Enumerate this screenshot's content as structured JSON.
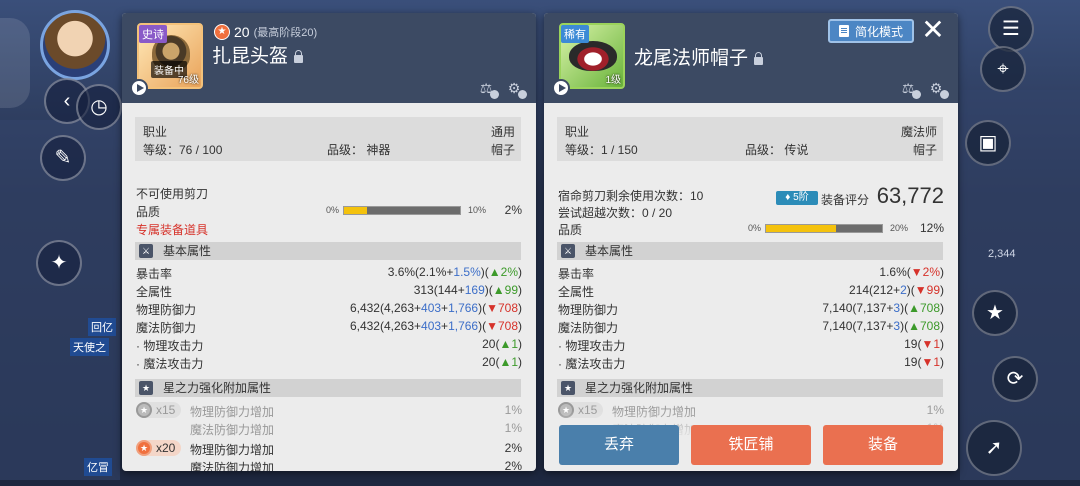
{
  "colors": {
    "panel_header": "#3c4a63",
    "accent_orange": "#ea7050",
    "accent_blue": "#4a7fab",
    "stat_up": "#3c9a2a",
    "stat_down": "#d6322a",
    "bonus_blue": "#3c6ec8"
  },
  "background": {
    "side_label_1": "回亿",
    "side_label_2": "天使之",
    "side_label_3": "亿冒",
    "right_value": "2,344"
  },
  "left_item": {
    "rarity": "史诗",
    "equipped_tag": "装备中",
    "level_tag": "76级",
    "star_count": "20",
    "star_max": "(最高阶段20)",
    "name": "扎昆头盔",
    "info": {
      "job_label": "职业",
      "job_value": "通用",
      "level": "等级：76 / 100",
      "grade": "品级：  神器",
      "type": "帽子"
    },
    "scissors": "不可使用剪刀",
    "quality_label": "品质",
    "quality_min": "0%",
    "quality_max": "10%",
    "quality_value": "2%",
    "quality_fill": 0.2,
    "exclusive": "专属装备道具",
    "basic_section": "基本属性",
    "stats": [
      {
        "name": "暴击率",
        "base": "3.6%(2.1%+",
        "bonus": "1.5%",
        "mid": ")(",
        "change": "▲2%",
        "change_dir": "up",
        "end": ")"
      },
      {
        "name": "全属性",
        "base": "313(144+",
        "bonus": "169",
        "mid": ")(",
        "change": "▲99",
        "change_dir": "up",
        "end": ")"
      },
      {
        "name": "物理防御力",
        "base": "6,432(4,263+",
        "bonus": "403",
        "mid": "+",
        "bonus2": "1,766",
        "mid2": ")(",
        "change": "▼708",
        "change_dir": "down",
        "end": ")"
      },
      {
        "name": "魔法防御力",
        "base": "6,432(4,263+",
        "bonus": "403",
        "mid": "+",
        "bonus2": "1,766",
        "mid2": ")(",
        "change": "▼708",
        "change_dir": "down",
        "end": ")"
      },
      {
        "name": "·  物理攻击力",
        "base": "20(",
        "change": "▲1",
        "change_dir": "up",
        "end": ")"
      },
      {
        "name": "·  魔法攻击力",
        "base": "20(",
        "change": "▲1",
        "change_dir": "up",
        "end": ")"
      }
    ],
    "star_section": "星之力强化附加属性",
    "star_rows": [
      {
        "count": "x15",
        "active": false,
        "name": "物理防御力增加",
        "value": "1%"
      },
      {
        "name": "魔法防御力增加",
        "value": "1%"
      },
      {
        "count": "x20",
        "active": true,
        "name": "物理防御力增加",
        "value": "2%"
      },
      {
        "name": "魔法防御力增加",
        "value": "2%"
      }
    ]
  },
  "right_item": {
    "rarity": "稀有",
    "level_tag": "1级",
    "name": "龙尾法师帽子",
    "simplify_label": "简化模式",
    "close_label": "✕",
    "info": {
      "job_label": "职业",
      "job_value": "魔法师",
      "level": "等级：1 / 150",
      "grade": "品级：  传说",
      "type": "帽子"
    },
    "scissors": "宿命剪刀剩余使用次数：10",
    "attempts": "尝试超越次数：0 / 20",
    "grade_badge": "5阶",
    "score_label": "装备评分",
    "score_value": "63,772",
    "quality_label": "品质",
    "quality_min": "0%",
    "quality_max": "20%",
    "quality_value": "12%",
    "quality_fill": 0.6,
    "basic_section": "基本属性",
    "stats": [
      {
        "name": "暴击率",
        "base": "1.6%(",
        "change": "▼2%",
        "change_dir": "down",
        "end": ")"
      },
      {
        "name": "全属性",
        "base": "214(212+",
        "bonus": "2",
        "mid": ")(",
        "change": "▼99",
        "change_dir": "down",
        "end": ")"
      },
      {
        "name": "物理防御力",
        "base": "7,140(7,137+",
        "bonus": "3",
        "mid": ")(",
        "change": "▲708",
        "change_dir": "up",
        "end": ")"
      },
      {
        "name": "魔法防御力",
        "base": "7,140(7,137+",
        "bonus": "3",
        "mid": ")(",
        "change": "▲708",
        "change_dir": "up",
        "end": ")"
      },
      {
        "name": "·  物理攻击力",
        "base": "19(",
        "change": "▼1",
        "change_dir": "down",
        "end": ")"
      },
      {
        "name": "·  魔法攻击力",
        "base": "19(",
        "change": "▼1",
        "change_dir": "down",
        "end": ")"
      }
    ],
    "star_section": "星之力强化附加属性",
    "star_rows": [
      {
        "count": "x15",
        "active": false,
        "name": "物理防御力增加",
        "value": "1%"
      },
      {
        "name": "魔法防御力增加",
        "value": "1%"
      }
    ],
    "buttons": {
      "discard": "丢弃",
      "smith": "铁匠铺",
      "equip": "装备"
    }
  }
}
